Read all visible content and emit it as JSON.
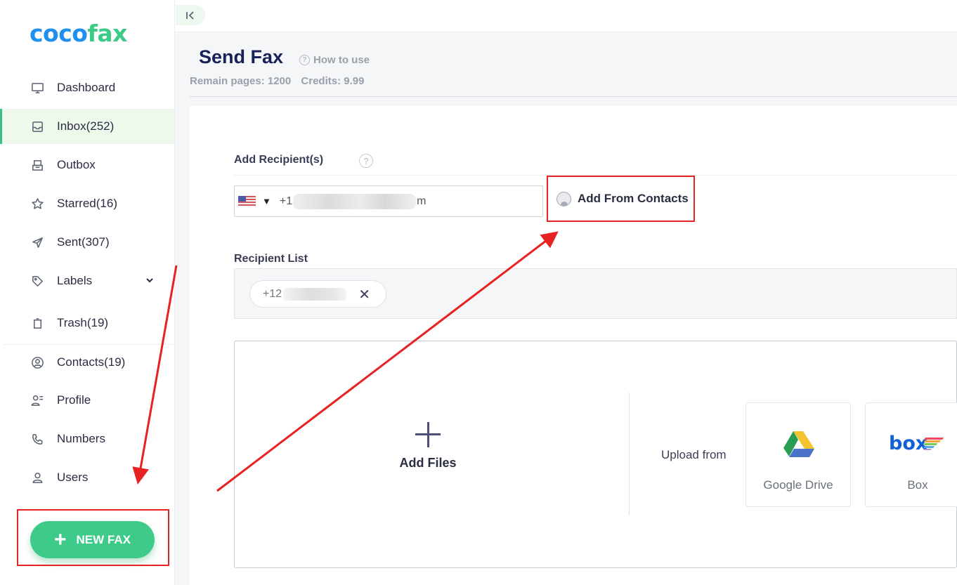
{
  "app": {
    "logo_part1": "coco",
    "logo_part2": "fax",
    "brand_colors": {
      "blue": "#1f8ff0",
      "green": "#3ccb87",
      "active_bg": "#eef9ec",
      "annotation_red": "#e62222"
    }
  },
  "sidebar": {
    "items": [
      {
        "label": "Dashboard",
        "icon": "monitor-icon"
      },
      {
        "label": "Inbox(252)",
        "icon": "inbox-icon",
        "active": true
      },
      {
        "label": "Outbox",
        "icon": "outbox-icon"
      },
      {
        "label": "Starred(16)",
        "icon": "star-icon"
      },
      {
        "label": "Sent(307)",
        "icon": "send-icon"
      },
      {
        "label": "Labels",
        "icon": "tag-icon",
        "expandable": true
      },
      {
        "label": "Trash(19)",
        "icon": "trash-icon"
      },
      {
        "label": "Contacts(19)",
        "icon": "contact-circle-icon"
      },
      {
        "label": "Profile",
        "icon": "profile-icon"
      },
      {
        "label": "Numbers",
        "icon": "phone-icon"
      },
      {
        "label": "Users",
        "icon": "user-icon"
      }
    ],
    "new_fax_label": "NEW FAX"
  },
  "header": {
    "title": "Send Fax",
    "how_to_use": "How to use",
    "remain_pages": "Remain pages: 1200",
    "credits": "Credits: 9.99"
  },
  "form": {
    "add_recipients_label": "Add Recipient(s)",
    "phone_prefix": "+1",
    "phone_suffix": "m",
    "country": "US",
    "add_from_contacts": "Add From Contacts",
    "recipient_list_label": "Recipient List",
    "recipients": [
      {
        "value_prefix": "+12"
      }
    ],
    "add_files": "Add Files",
    "upload_from": "Upload from",
    "sources": [
      {
        "name": "Google Drive",
        "icon": "google-drive-icon"
      },
      {
        "name": "Box",
        "icon": "box-icon"
      }
    ]
  }
}
